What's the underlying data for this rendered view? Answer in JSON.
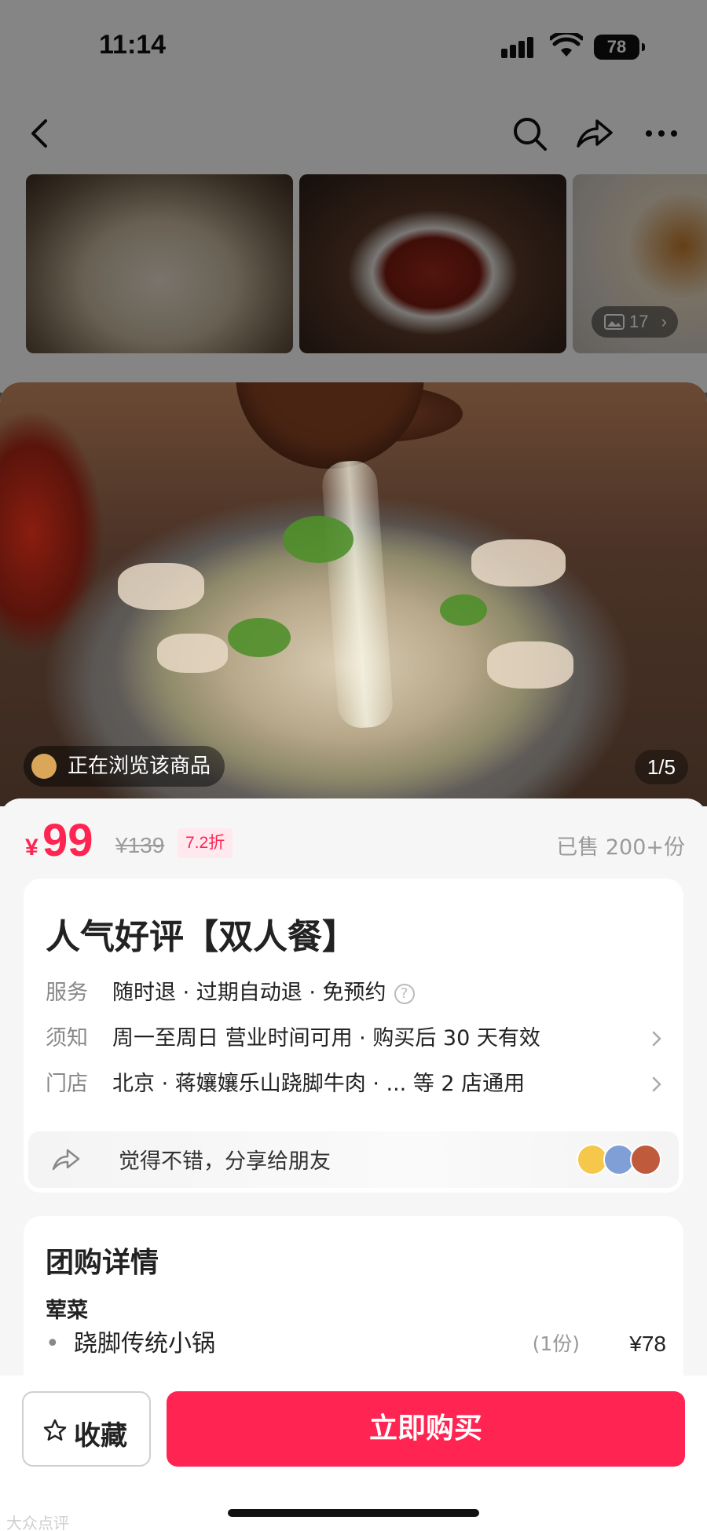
{
  "status_bar": {
    "time": "11:14",
    "battery": "78"
  },
  "background_page": {
    "thumbnail_photo_count": "17",
    "nav_icons": [
      "back-icon",
      "search-icon",
      "share-icon",
      "more-icon"
    ]
  },
  "hero": {
    "browsing_badge": "正在浏览该商品",
    "page_counter": "1/5"
  },
  "price": {
    "currency_symbol": "¥",
    "current": "99",
    "original": "¥139",
    "discount": "7.2折",
    "sold": "已售 200+份",
    "accent_color": "#ff2451"
  },
  "deal": {
    "title": "人气好评【双人餐】",
    "rows": [
      {
        "key": "服务",
        "value": "随时退 · 过期自动退 · 免预约",
        "help_icon": "?"
      },
      {
        "key": "须知",
        "value": "周一至周日 营业时间可用 · 购买后 30 天有效"
      },
      {
        "key": "门店",
        "value": "北京 · 蒋孃孃乐山跷脚牛肉 · ... 等 2 店通用"
      }
    ],
    "share_text": "觉得不错，分享给朋友"
  },
  "detail": {
    "title": "团购详情",
    "category": "荤菜",
    "items": [
      {
        "bullet": "•",
        "name": "跷脚传统小锅",
        "qty": "(1份)",
        "price": "¥78"
      }
    ]
  },
  "bottom_bar": {
    "favorite_label": "收藏",
    "buy_label": "立即购买",
    "watermark": "大众点评"
  }
}
